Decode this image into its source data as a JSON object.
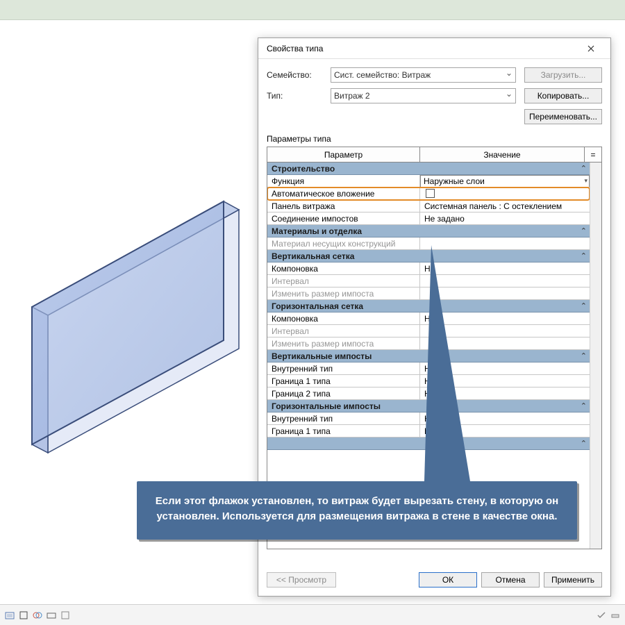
{
  "dialog": {
    "title": "Свойства типа",
    "family_label": "Семейство:",
    "family_value": "Сист. семейство: Витраж",
    "type_label": "Тип:",
    "type_value": "Витраж 2",
    "load_btn": "Загрузить...",
    "dup_btn": "Копировать...",
    "rename_btn": "Переименовать...",
    "params_label": "Параметры типа",
    "col_param": "Параметр",
    "col_value": "Значение",
    "col_eq": "=",
    "preview_btn": "<< Просмотр",
    "ok_btn": "ОК",
    "cancel_btn": "Отмена",
    "apply_btn": "Применить"
  },
  "groups": [
    {
      "title": "Строительство",
      "rows": [
        {
          "name": "Функция",
          "value": "Наружные слои",
          "kind": "dropdown"
        },
        {
          "name": "Автоматическое вложение",
          "value": "",
          "kind": "checkbox",
          "highlight": true
        },
        {
          "name": "Панель витража",
          "value": "Системная панель : С остеклением",
          "kind": "text"
        },
        {
          "name": "Соединение импостов",
          "value": "Не задано",
          "kind": "text"
        }
      ]
    },
    {
      "title": "Материалы и отделка",
      "rows": [
        {
          "name": "Материал несущих конструкций",
          "value": "",
          "kind": "text",
          "disabled": true
        }
      ]
    },
    {
      "title": "Вертикальная сетка",
      "rows": [
        {
          "name": "Компоновка",
          "value": "Н",
          "kind": "text"
        },
        {
          "name": "Интервал",
          "value": "",
          "kind": "text",
          "disabled": true
        },
        {
          "name": "Изменить размер импоста",
          "value": "",
          "kind": "text",
          "disabled": true
        }
      ]
    },
    {
      "title": "Горизонтальная сетка",
      "rows": [
        {
          "name": "Компоновка",
          "value": "Н",
          "kind": "text"
        },
        {
          "name": "Интервал",
          "value": "",
          "kind": "text",
          "disabled": true
        },
        {
          "name": "Изменить размер импоста",
          "value": "",
          "kind": "text",
          "disabled": true
        }
      ]
    },
    {
      "title": "Вертикальные импосты",
      "rows": [
        {
          "name": "Внутренний тип",
          "value": "Н",
          "kind": "text"
        },
        {
          "name": "Граница 1 типа",
          "value": "Н",
          "kind": "text"
        },
        {
          "name": "Граница 2 типа",
          "value": "Н",
          "kind": "text"
        }
      ]
    },
    {
      "title": "Горизонтальные импосты",
      "rows": [
        {
          "name": "Внутренний тип",
          "value": "Н",
          "kind": "text"
        },
        {
          "name": "Граница 1 типа",
          "value": "Н",
          "kind": "text"
        }
      ]
    }
  ],
  "hidden_group": {
    "title": ""
  },
  "callout": "Если этот флажок установлен, то витраж будет вырезать стену, в которую он установлен. Используется для размещения витража в стене в качестве окна."
}
